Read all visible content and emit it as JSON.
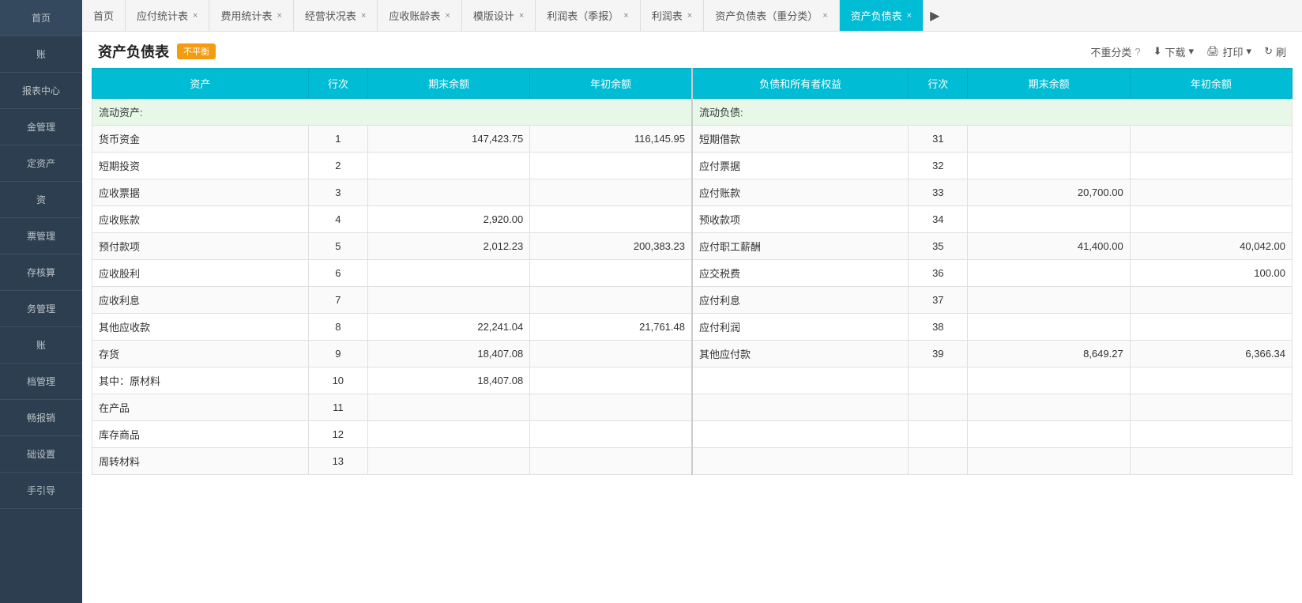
{
  "sidebar": {
    "items": [
      {
        "id": "home",
        "label": "首页"
      },
      {
        "id": "account",
        "label": "账"
      },
      {
        "id": "report-center",
        "label": "报表中心"
      },
      {
        "id": "fund-mgmt",
        "label": "金管理"
      },
      {
        "id": "fixed-assets",
        "label": "定资产"
      },
      {
        "id": "invest",
        "label": "资"
      },
      {
        "id": "ticket-mgmt",
        "label": "票管理"
      },
      {
        "id": "inventory-calc",
        "label": "存核算"
      },
      {
        "id": "tax-mgmt",
        "label": "务管理"
      },
      {
        "id": "ledger",
        "label": "账"
      },
      {
        "id": "archive-mgmt",
        "label": "档管理"
      },
      {
        "id": "sales",
        "label": "畅报销"
      },
      {
        "id": "basic-settings",
        "label": "础设置"
      },
      {
        "id": "guide",
        "label": "手引导"
      }
    ]
  },
  "tabs": [
    {
      "id": "home",
      "label": "首页",
      "closable": false,
      "active": false
    },
    {
      "id": "ap-stats",
      "label": "应付统计表",
      "closable": true,
      "active": false
    },
    {
      "id": "expense-stats",
      "label": "费用统计表",
      "closable": true,
      "active": false
    },
    {
      "id": "business-status",
      "label": "经营状况表",
      "closable": true,
      "active": false
    },
    {
      "id": "ar-aging",
      "label": "应收账龄表",
      "closable": true,
      "active": false
    },
    {
      "id": "template-design",
      "label": "模版设计",
      "closable": true,
      "active": false
    },
    {
      "id": "profit-quarterly",
      "label": "利润表（季报）",
      "closable": true,
      "active": false
    },
    {
      "id": "profit-table",
      "label": "利润表",
      "closable": true,
      "active": false
    },
    {
      "id": "balance-reclassify",
      "label": "资产负债表（重分类）",
      "closable": true,
      "active": false
    },
    {
      "id": "balance-sheet",
      "label": "资产负债表",
      "closable": true,
      "active": true
    }
  ],
  "tab_arrow_label": "▶",
  "page": {
    "title": "资产负债表",
    "badge": "不平衡",
    "no_classify_label": "不重分类",
    "download_label": "下载",
    "print_label": "打印",
    "refresh_label": "刷"
  },
  "table": {
    "headers": {
      "asset": "资产",
      "row_num": "行次",
      "end_balance": "期末余额",
      "year_start_balance": "年初余额",
      "liability_equity": "负债和所有者权益",
      "row_num2": "行次",
      "end_balance2": "期末余额",
      "year_start_balance2": "年初余额"
    },
    "section_current_assets": "流动资产:",
    "section_current_liabilities": "流动负债:",
    "rows": [
      {
        "asset_label": "货币资金",
        "asset_indent": false,
        "row_num": "1",
        "end_balance": "147,423.75",
        "year_start_balance": "116,145.95",
        "liability_label": "短期借款",
        "liability_indent": false,
        "row_num2": "31",
        "end_balance2": "",
        "year_start_balance2": ""
      },
      {
        "asset_label": "短期投资",
        "asset_indent": false,
        "row_num": "2",
        "end_balance": "",
        "year_start_balance": "",
        "liability_label": "应付票据",
        "liability_indent": false,
        "row_num2": "32",
        "end_balance2": "",
        "year_start_balance2": ""
      },
      {
        "asset_label": "应收票据",
        "asset_indent": false,
        "row_num": "3",
        "end_balance": "",
        "year_start_balance": "",
        "liability_label": "应付账款",
        "liability_indent": false,
        "row_num2": "33",
        "end_balance2": "20,700.00",
        "year_start_balance2": ""
      },
      {
        "asset_label": "应收账款",
        "asset_indent": false,
        "row_num": "4",
        "end_balance": "2,920.00",
        "year_start_balance": "",
        "liability_label": "预收款项",
        "liability_indent": false,
        "row_num2": "34",
        "end_balance2": "",
        "year_start_balance2": ""
      },
      {
        "asset_label": "预付款项",
        "asset_indent": false,
        "row_num": "5",
        "end_balance": "2,012.23",
        "year_start_balance": "200,383.23",
        "liability_label": "应付职工薪酬",
        "liability_indent": false,
        "row_num2": "35",
        "end_balance2": "41,400.00",
        "year_start_balance2": "40,042.00"
      },
      {
        "asset_label": "应收股利",
        "asset_indent": false,
        "row_num": "6",
        "end_balance": "",
        "year_start_balance": "",
        "liability_label": "应交税费",
        "liability_indent": false,
        "row_num2": "36",
        "end_balance2": "",
        "year_start_balance2": "100.00"
      },
      {
        "asset_label": "应收利息",
        "asset_indent": false,
        "row_num": "7",
        "end_balance": "",
        "year_start_balance": "",
        "liability_label": "应付利息",
        "liability_indent": false,
        "row_num2": "37",
        "end_balance2": "",
        "year_start_balance2": ""
      },
      {
        "asset_label": "其他应收款",
        "asset_indent": false,
        "row_num": "8",
        "end_balance": "22,241.04",
        "year_start_balance": "21,761.48",
        "liability_label": "应付利润",
        "liability_indent": false,
        "row_num2": "38",
        "end_balance2": "",
        "year_start_balance2": ""
      },
      {
        "asset_label": "存货",
        "asset_indent": false,
        "row_num": "9",
        "end_balance": "18,407.08",
        "year_start_balance": "",
        "liability_label": "其他应付款",
        "liability_indent": false,
        "row_num2": "39",
        "end_balance2": "8,649.27",
        "year_start_balance2": "6,366.34"
      },
      {
        "asset_label": "其中：原材料",
        "asset_indent": true,
        "row_num": "10",
        "end_balance": "18,407.08",
        "year_start_balance": "",
        "liability_label": "",
        "liability_indent": false,
        "row_num2": "",
        "end_balance2": "",
        "year_start_balance2": ""
      },
      {
        "asset_label": "在产品",
        "asset_indent": true,
        "row_num": "11",
        "end_balance": "",
        "year_start_balance": "",
        "liability_label": "",
        "liability_indent": false,
        "row_num2": "",
        "end_balance2": "",
        "year_start_balance2": ""
      },
      {
        "asset_label": "库存商品",
        "asset_indent": true,
        "row_num": "12",
        "end_balance": "",
        "year_start_balance": "",
        "liability_label": "",
        "liability_indent": false,
        "row_num2": "",
        "end_balance2": "",
        "year_start_balance2": ""
      },
      {
        "asset_label": "周转材料",
        "asset_indent": true,
        "row_num": "13",
        "end_balance": "",
        "year_start_balance": "",
        "liability_label": "",
        "liability_indent": false,
        "row_num2": "",
        "end_balance2": "",
        "year_start_balance2": ""
      }
    ]
  },
  "icons": {
    "close": "×",
    "arrow_right": "▶",
    "question": "?",
    "download": "⬇",
    "print": "🖨",
    "refresh": "↻",
    "chevron_down": "▾"
  }
}
